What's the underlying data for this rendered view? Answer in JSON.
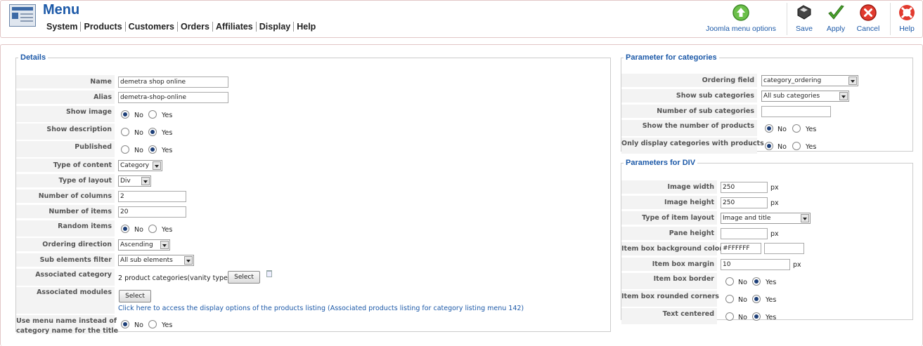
{
  "header": {
    "title": "Menu",
    "nav": [
      "System",
      "Products",
      "Customers",
      "Orders",
      "Affiliates",
      "Display",
      "Help"
    ],
    "toolbar": {
      "menu_options": "Joomla menu options",
      "save": "Save",
      "apply": "Apply",
      "cancel": "Cancel",
      "help": "Help"
    }
  },
  "details": {
    "legend": "Details",
    "name_label": "Name",
    "name_value": "demetra shop online",
    "alias_label": "Alias",
    "alias_value": "demetra-shop-online",
    "show_image_label": "Show image",
    "show_description_label": "Show description",
    "published_label": "Published",
    "type_of_content_label": "Type of content",
    "type_of_content_value": "Category",
    "type_of_layout_label": "Type of layout",
    "type_of_layout_value": "Div",
    "number_of_columns_label": "Number of columns",
    "number_of_columns_value": "2",
    "number_of_items_label": "Number of items",
    "number_of_items_value": "20",
    "random_items_label": "Random items",
    "ordering_direction_label": "Ordering direction",
    "ordering_direction_value": "Ascending",
    "sub_elements_filter_label": "Sub elements filter",
    "sub_elements_filter_value": "All sub elements",
    "associated_category_label": "Associated category",
    "associated_category_text": "2 product categories(vanity type)",
    "associated_modules_label": "Associated modules",
    "select_label": "Select",
    "display_options_link": "Click here to access the display options of the products listing (Associated products listing for category listing menu 142)",
    "use_menu_name_label_1": "Use menu name instead of",
    "use_menu_name_label_2": "category name for the title",
    "no": "No",
    "yes": "Yes",
    "state": {
      "show_image": "No",
      "show_description": "Yes",
      "published": "Yes",
      "random_items": "No",
      "use_menu_name": "No"
    }
  },
  "categories": {
    "legend": "Parameter for categories",
    "ordering_field_label": "Ordering field",
    "ordering_field_value": "category_ordering",
    "show_sub_categories_label": "Show sub categories",
    "show_sub_categories_value": "All sub categories",
    "number_of_sub_categories_label": "Number of sub categories",
    "number_of_sub_categories_value": "",
    "show_number_of_products_label": "Show the number of products",
    "only_display_with_products_label": "Only display categories with products",
    "state": {
      "show_number_of_products": "No",
      "only_display_with_products": "No"
    }
  },
  "div_params": {
    "legend": "Parameters for DIV",
    "image_width_label": "Image width",
    "image_width_value": "250",
    "image_height_label": "Image height",
    "image_height_value": "250",
    "type_of_item_layout_label": "Type of item layout",
    "type_of_item_layout_value": "Image and title",
    "pane_height_label": "Pane height",
    "pane_height_value": "",
    "item_box_bg_label": "Item box background color",
    "item_box_bg_value": "#FFFFFF",
    "item_box_margin_label": "Item box margin",
    "item_box_margin_value": "10",
    "item_box_border_label": "Item box border",
    "item_box_rounded_label": "Item box rounded corners",
    "text_centered_label": "Text centered",
    "px": "px",
    "state": {
      "item_box_border": "Yes",
      "item_box_rounded": "Yes",
      "text_centered": "Yes"
    }
  },
  "colors": {
    "accent": "#1c59a8",
    "label_bg": "#f3f3f3",
    "header_border": "#e2c6c6"
  },
  "icons": [
    "menu-manager-icon",
    "options-icon",
    "save-icon",
    "apply-icon",
    "cancel-icon",
    "help-icon",
    "trash-icon"
  ]
}
